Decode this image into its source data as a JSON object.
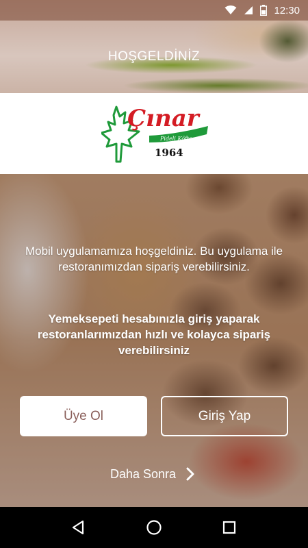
{
  "status_bar": {
    "time": "12:30"
  },
  "header": {
    "title": "HOŞGELDİNİZ"
  },
  "logo": {
    "name": "Çınar",
    "tagline": "Pideli Köfte",
    "year": "1964",
    "colors": {
      "red": "#d41c24",
      "green": "#1f9a3a"
    }
  },
  "content": {
    "intro": "Mobil uygulamamıza hoşgeldiniz. Bu uygulama ile restoranımızdan sipariş verebilirsiniz.",
    "yemeksepeti_note": "Yemeksepeti hesabınızla giriş yaparak restoranlarımızdan hızlı ve kolayca sipariş verebilirsiniz"
  },
  "actions": {
    "signup_label": "Üye Ol",
    "login_label": "Giriş Yap",
    "later_label": "Daha Sonra"
  },
  "nav": {
    "back": "back-icon",
    "home": "home-icon",
    "recents": "recents-icon"
  }
}
